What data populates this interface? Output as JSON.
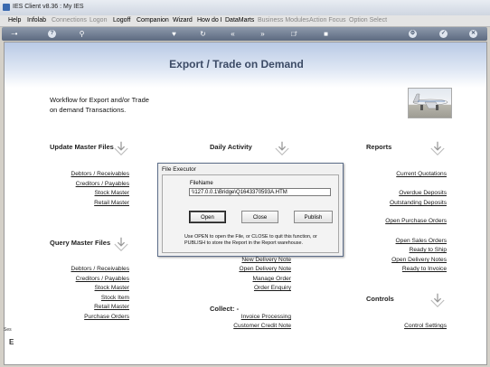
{
  "window": {
    "title": "IES Client v8.36 : My IES"
  },
  "menu": [
    {
      "label": "Help",
      "enabled": true
    },
    {
      "label": "Infolab",
      "enabled": true
    },
    {
      "label": "Connections",
      "enabled": false
    },
    {
      "label": "Logon",
      "enabled": false
    },
    {
      "label": "Logoff",
      "enabled": true
    },
    {
      "label": "Companion",
      "enabled": true
    },
    {
      "label": "Wizard",
      "enabled": true
    },
    {
      "label": "How do I",
      "enabled": true
    },
    {
      "label": "DataMarts",
      "enabled": true
    },
    {
      "label": "Business Modules",
      "enabled": false
    },
    {
      "label": "Action Focus",
      "enabled": false
    },
    {
      "label": "Option Select",
      "enabled": false
    }
  ],
  "toolbar": {
    "icons": [
      "key-icon",
      "help-icon",
      "search-icon",
      "heart-icon",
      "refresh-icon",
      "rewind-icon",
      "forward-icon",
      "document-icon",
      "up-icon",
      "stop-icon",
      "settings-icon",
      "check-icon",
      "close-icon"
    ]
  },
  "page": {
    "title": "Export / Trade on Demand",
    "description_line1": "Workflow for Export and/or Trade",
    "description_line2": "on demand Transactions."
  },
  "sections": {
    "update_master": {
      "title": "Update Master Files",
      "links": [
        "Debtors / Receivables",
        "Creditors / Payables",
        "Stock Master",
        "Retail Master"
      ]
    },
    "query_master": {
      "title": "Query Master Files",
      "links": [
        "Debtors / Receivables",
        "Creditors / Payables",
        "Stock Master",
        "Stock Item",
        "Retail Master",
        "Purchase Orders"
      ]
    },
    "daily": {
      "title": "Daily Activity",
      "links": [
        "New Delivery Note",
        "Open Delivery Note",
        "Manage Order",
        "Order Enquiry"
      ]
    },
    "collect": {
      "title": "Collect: -",
      "links": [
        "Invoice Processing",
        "Customer Credit Note"
      ]
    },
    "reports": {
      "title": "Reports",
      "links": [
        "Current Quotations",
        "Overdue Deposits",
        "Outstanding Deposits",
        "Open Purchase Orders",
        "Open Sales Orders",
        "Ready to Ship",
        "Open Delivery Notes",
        "Ready to Invoice"
      ]
    },
    "controls": {
      "title": "Controls",
      "links": [
        "Control Settings"
      ]
    }
  },
  "dialog": {
    "title": "File Executor",
    "field_label": "FileName",
    "field_value": "\\\\127.0.0.1\\Bridge\\Q1643370593A.HTM",
    "buttons": {
      "open": "Open",
      "close": "Close",
      "publish": "Publish"
    },
    "help_text": "Use OPEN to open the File, or CLOSE to quit this function, or PUBLISH to store the Report in the Report warehouse."
  },
  "side_fragments": {
    "small": "Ses",
    "big": "E"
  }
}
